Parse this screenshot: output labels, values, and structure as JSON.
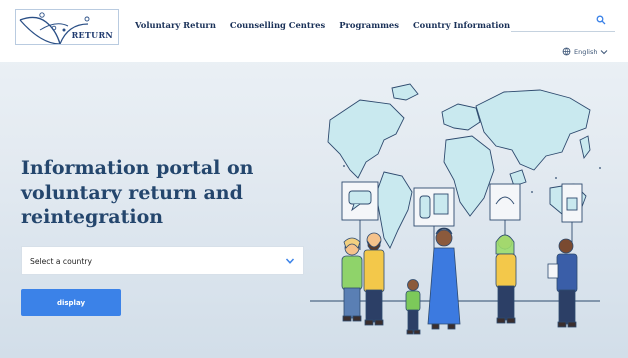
{
  "header": {
    "logo_text": "RETURN",
    "nav": [
      {
        "label": "Voluntary Return"
      },
      {
        "label": "Counselling Centres"
      },
      {
        "label": "Programmes"
      },
      {
        "label": "Country Information"
      }
    ],
    "search": {
      "placeholder": "",
      "icon": "search-icon"
    },
    "language": {
      "label": "English",
      "icon": "language-icon"
    }
  },
  "hero": {
    "title": "Information portal on voluntary return and reintegration",
    "select": {
      "value": "Select a country",
      "icon": "chevron-down-icon"
    },
    "button_label": "display"
  },
  "colors": {
    "accent": "#3b82e8",
    "title": "#24466d",
    "nav_text": "#1a3158",
    "map": "#c9e9ef"
  }
}
